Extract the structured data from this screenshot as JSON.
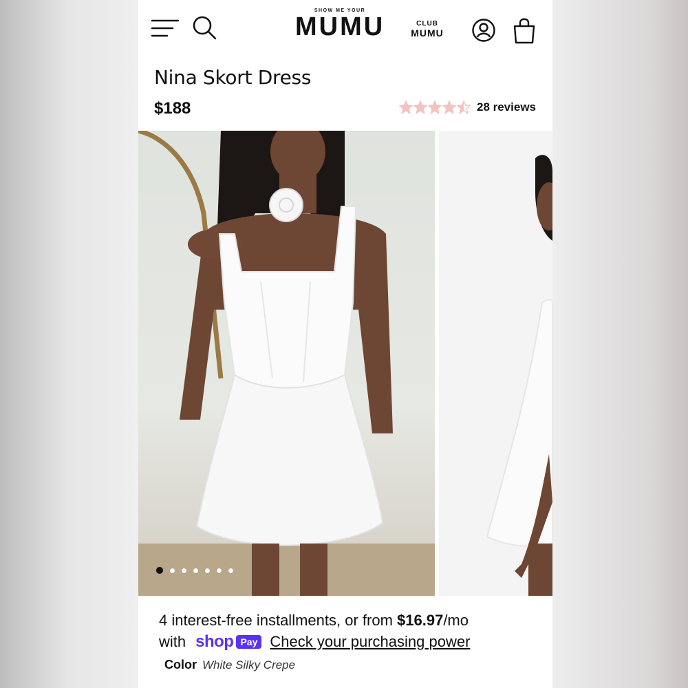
{
  "header": {
    "logo_tagline": "SHOW ME YOUR",
    "logo_name": "MUMU",
    "club_top": "CLUB",
    "club_bottom": "MUMU",
    "icons": [
      "menu-icon",
      "search-icon",
      "account-icon",
      "bag-icon"
    ]
  },
  "product": {
    "title": "Nina Skort Dress",
    "price": "$188",
    "rating": 4.5,
    "rating_max": 5,
    "reviews": "28 reviews",
    "star_color": "#f2c4c0"
  },
  "gallery": {
    "slide_count": 7,
    "active_index": 0
  },
  "payment": {
    "installments_prefix": "4 interest-free installments, or from ",
    "installments_amount": "$16.97",
    "installments_suffix": "/mo",
    "with": "with",
    "shop_logo": "shop",
    "pay_badge": "Pay",
    "power_link": "Check your purchasing power",
    "shop_color": "#5a31f4"
  },
  "color": {
    "label": "Color",
    "value": "White Silky Crepe"
  }
}
